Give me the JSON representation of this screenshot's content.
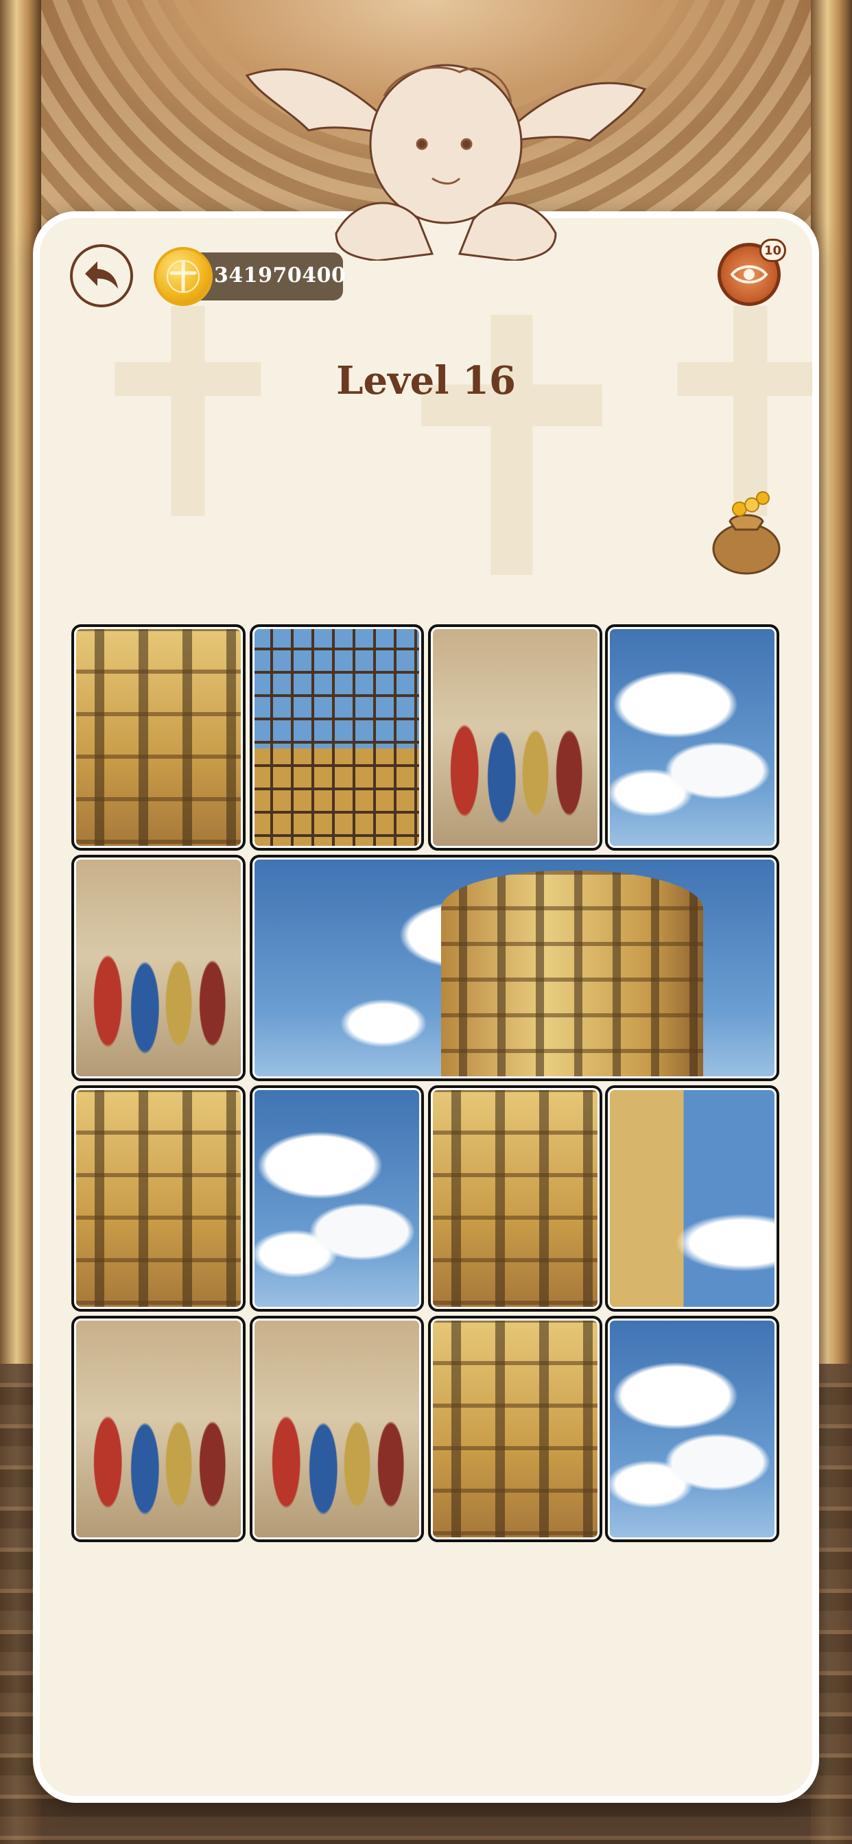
{
  "header": {
    "coins": "341970400",
    "hint_badge": "10"
  },
  "level": {
    "title": "Level 16"
  },
  "puzzle": {
    "rows": 4,
    "cols": 4,
    "tiles": [
      {
        "id": "r1c1",
        "kind": "tower"
      },
      {
        "id": "r1c2",
        "kind": "scaffold"
      },
      {
        "id": "r1c3",
        "kind": "people"
      },
      {
        "id": "r1c4",
        "kind": "sky"
      },
      {
        "id": "r2c1",
        "kind": "people"
      },
      {
        "id": "r2c2-r2c4",
        "kind": "merged-tower"
      },
      {
        "id": "r3c1",
        "kind": "tower"
      },
      {
        "id": "r3c2",
        "kind": "sky"
      },
      {
        "id": "r3c3",
        "kind": "tower"
      },
      {
        "id": "r3c4",
        "kind": "mix"
      },
      {
        "id": "r4c1",
        "kind": "people"
      },
      {
        "id": "r4c2",
        "kind": "people"
      },
      {
        "id": "r4c3",
        "kind": "tower"
      },
      {
        "id": "r4c4",
        "kind": "sky"
      }
    ]
  },
  "icons": {
    "back": "back-arrow-icon",
    "coin": "coin-icon",
    "hint": "eye-icon",
    "bag": "coin-bag-icon",
    "cherub": "cherub-illustration"
  },
  "colors": {
    "card": "#f7f1e3",
    "title": "#6a3a21",
    "coin_pill": "#6b5a45",
    "hint_button": "#c9622e",
    "tile_border": "#111111"
  }
}
